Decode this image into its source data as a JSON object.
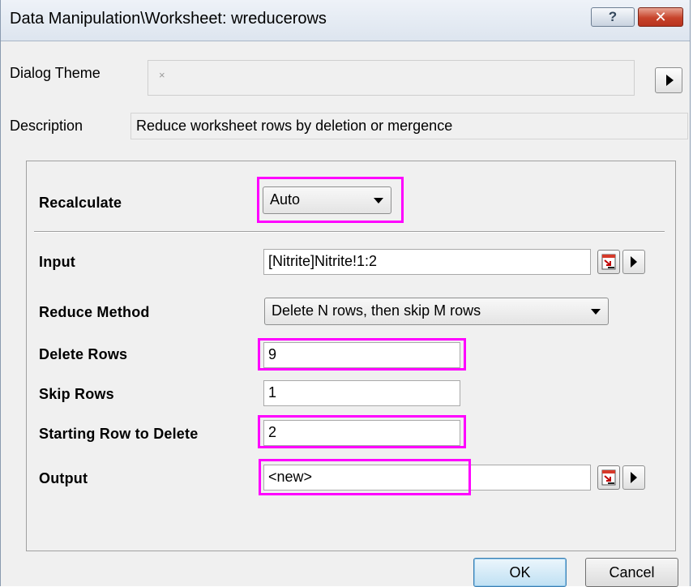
{
  "window": {
    "title": "Data Manipulation\\Worksheet: wreducerows",
    "help_label": "?",
    "close_label": "✕"
  },
  "theme": {
    "label": "Dialog Theme",
    "value": "×"
  },
  "description": {
    "label": "Description",
    "value": "Reduce worksheet rows by deletion or mergence"
  },
  "recalculate": {
    "label": "Recalculate",
    "value": "Auto"
  },
  "input": {
    "label": "Input",
    "value": "[Nitrite]Nitrite!1:2"
  },
  "reduce_method": {
    "label": "Reduce Method",
    "value": "Delete N rows, then skip M rows"
  },
  "delete_rows": {
    "label": "Delete Rows",
    "value": "9"
  },
  "skip_rows": {
    "label": "Skip Rows",
    "value": "1"
  },
  "starting_row": {
    "label": "Starting Row to Delete",
    "value": "2"
  },
  "output": {
    "label": "Output",
    "value": "<new>"
  },
  "buttons": {
    "ok": "OK",
    "cancel": "Cancel"
  },
  "colors": {
    "highlight": "#ff00ff",
    "close_button": "#c7432b"
  }
}
